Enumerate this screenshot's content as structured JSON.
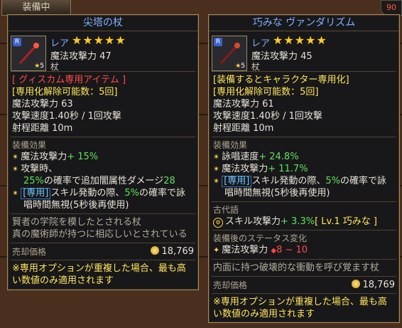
{
  "top_tab": "装備中",
  "right_badge": "90",
  "left_item": {
    "title": "尖塔の杖",
    "rarity": "レア",
    "stars": "★★★★★",
    "badge": "R",
    "level": "5",
    "header_stat": "魔法攻撃力 47",
    "type": "杖",
    "restriction": "[ グィスカム専用アイテム ]",
    "dedicate": "[専用化解除可能数：5回]",
    "stats": [
      "魔法攻撃力 63",
      "攻撃速度1.40秒 / 1回攻撃",
      "射程距離 10m"
    ],
    "effects_title": "装備効果",
    "effects": [
      {
        "pre": "魔法攻撃力",
        "val": "+ 15%"
      },
      {
        "pre": "攻撃時、",
        "line2a": "25%",
        "line2b": "の確率で追加闇属性ダメージ",
        "line2c": "28"
      },
      {
        "tag": "[専用]",
        "pre": "スキル発動の際、",
        "pct": "5%",
        "post": "の確率で詠",
        "line2": "唱時間無視(5秒後再使用)"
      }
    ],
    "description": [
      "賢者の学院を模したとされる杖",
      "真の魔術師が持つに相応しいとされている"
    ],
    "price_label": "売却価格",
    "price": "18,769",
    "notice": [
      "※専用オプションが重複した場合、最も高",
      "い数値のみ適用されます"
    ]
  },
  "right_item": {
    "title": "巧みな ヴァンダリズム",
    "rarity": "レア",
    "stars": "★★★★★",
    "badge": "R",
    "level": "5",
    "header_stat": "魔法攻撃力 45",
    "type": "杖",
    "restriction": "[装備するとキャラクター専用化]",
    "dedicate": "[専用化解除可能数：5回]",
    "stats": [
      "魔法攻撃力 61",
      "攻撃速度1.40秒 / 1回攻撃",
      "射程距離 10m"
    ],
    "effects_title": "装備効果",
    "effects": [
      {
        "pre": "詠唱速度",
        "val": "+ 24.8%"
      },
      {
        "pre": "魔法攻撃力",
        "val": "+ 11.7%"
      },
      {
        "tag": "[専用]",
        "pre": "スキル発動の際、",
        "pct": "5%",
        "post": "の確率で詠",
        "line2": "唱時間無視(5秒後再使用)"
      }
    ],
    "ancient_title": "古代語",
    "ancient": {
      "pre": "スキル攻撃力",
      "val": "+ 3.3%",
      "post": "[ Lv.1 巧みな ]"
    },
    "after_title": "装備後のステータス変化",
    "after": {
      "label": "魔法攻撃力",
      "range": "8 ~ 10"
    },
    "description": [
      "内面に持つ破壊的な衝動を呼び覚ます杖"
    ],
    "price_label": "売却価格",
    "price": "18,769",
    "notice": [
      "※専用オプションが重複した場合、最も高",
      "い数値のみ適用されます"
    ]
  }
}
